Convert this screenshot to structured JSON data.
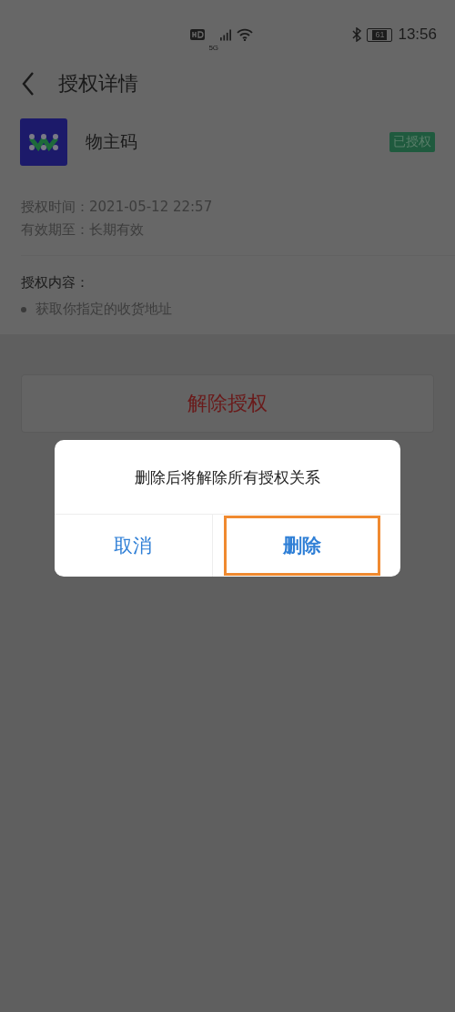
{
  "status_bar": {
    "network": "5G",
    "battery": "61",
    "time": "13:56"
  },
  "header": {
    "title": "授权详情"
  },
  "app": {
    "name": "物主码",
    "badge": "已授权"
  },
  "details": [
    {
      "label": "授权时间：",
      "value": "2021-05-12 22:57"
    },
    {
      "label": "有效期至：",
      "value": "长期有效"
    }
  ],
  "scope": {
    "title": "授权内容：",
    "items": [
      "获取你指定的收货地址"
    ]
  },
  "revoke_button": "解除授权",
  "dialog": {
    "message": "删除后将解除所有授权关系",
    "buttons": [
      {
        "label": "取消",
        "highlighted": false
      },
      {
        "label": "删除",
        "highlighted": true
      }
    ]
  }
}
